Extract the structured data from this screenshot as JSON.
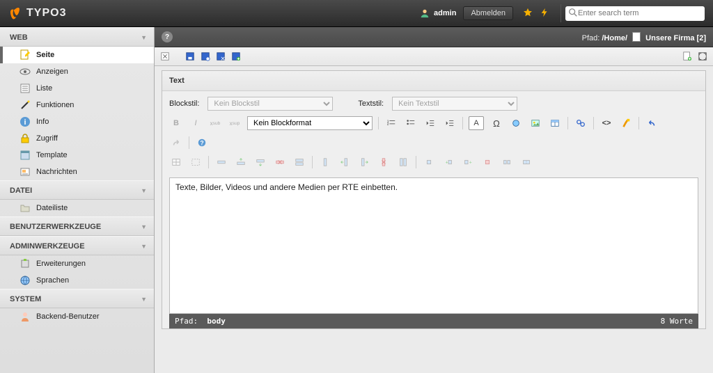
{
  "topbar": {
    "brand": "TYPO3",
    "user_name": "admin",
    "logout_label": "Abmelden",
    "search_placeholder": "Enter search term"
  },
  "sidebar": {
    "sections": [
      {
        "title": "WEB",
        "items": [
          {
            "label": "Seite",
            "icon": "page-edit",
            "active": true
          },
          {
            "label": "Anzeigen",
            "icon": "eye"
          },
          {
            "label": "Liste",
            "icon": "list"
          },
          {
            "label": "Funktionen",
            "icon": "wand"
          },
          {
            "label": "Info",
            "icon": "info"
          },
          {
            "label": "Zugriff",
            "icon": "lock"
          },
          {
            "label": "Template",
            "icon": "template"
          },
          {
            "label": "Nachrichten",
            "icon": "news"
          }
        ]
      },
      {
        "title": "DATEI",
        "items": [
          {
            "label": "Dateiliste",
            "icon": "folder"
          }
        ]
      },
      {
        "title": "BENUTZERWERKZEUGE",
        "items": []
      },
      {
        "title": "ADMINWERKZEUGE",
        "items": [
          {
            "label": "Erweiterungen",
            "icon": "plugin"
          },
          {
            "label": "Sprachen",
            "icon": "globe"
          }
        ]
      },
      {
        "title": "SYSTEM",
        "items": [
          {
            "label": "Backend-Benutzer",
            "icon": "user"
          }
        ]
      }
    ]
  },
  "docheader": {
    "path_label": "Pfad:",
    "path_home": "/Home/",
    "breadcrumb_page": "Unsere Firma",
    "breadcrumb_id": "[2]"
  },
  "panel": {
    "title": "Text",
    "blockstyle_label": "Blockstil:",
    "blockstyle_value": "Kein Blockstil",
    "textstyle_label": "Textstil:",
    "textstyle_value": "Kein Textstil",
    "blockformat_value": "Kein Blockformat",
    "editor_text": "Texte, Bilder, Videos und andere Medien per RTE einbetten."
  },
  "statusbar": {
    "path_label": "Pfad:",
    "path_value": "body",
    "wordcount": "8 Worte"
  }
}
